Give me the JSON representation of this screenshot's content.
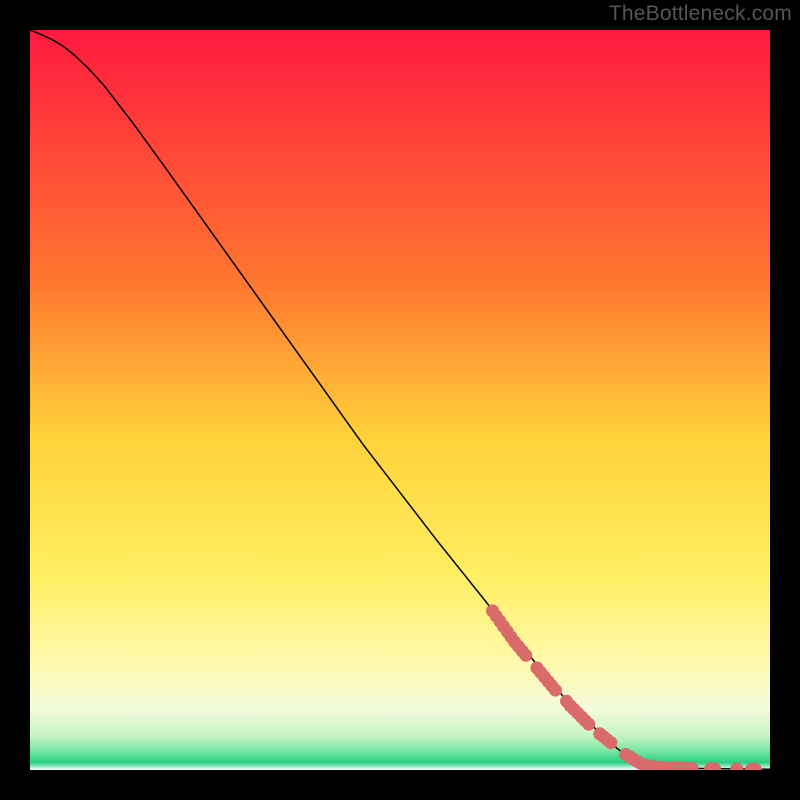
{
  "watermark": "TheBottleneck.com",
  "colors": {
    "top": "#ff193f",
    "orange": "#ff9e32",
    "yellow": "#ffe952",
    "cream": "#fffab0",
    "pale": "#f0fcdc",
    "mint": "#9aeeba",
    "green": "#28d082",
    "point_fill": "#d96b6b",
    "point_stroke": "#a73f3f",
    "curve": "#000000"
  },
  "chart_data": {
    "type": "line",
    "title": "",
    "xlabel": "",
    "ylabel": "",
    "xlim": [
      0,
      100
    ],
    "ylim": [
      0,
      100
    ],
    "gradient_stops": [
      {
        "offset": 0.0,
        "color": "#ff193f"
      },
      {
        "offset": 0.35,
        "color": "#ff7a2f"
      },
      {
        "offset": 0.55,
        "color": "#ffd23a"
      },
      {
        "offset": 0.74,
        "color": "#ffef62"
      },
      {
        "offset": 0.86,
        "color": "#fff9b0"
      },
      {
        "offset": 0.92,
        "color": "#f2fbdc"
      },
      {
        "offset": 0.955,
        "color": "#c4f3c3"
      },
      {
        "offset": 0.975,
        "color": "#72e6a3"
      },
      {
        "offset": 0.99,
        "color": "#29cf82"
      },
      {
        "offset": 1.0,
        "color": "#ffffff"
      }
    ],
    "curve": [
      {
        "x": 0.0,
        "y": 100.0
      },
      {
        "x": 1.5,
        "y": 99.4
      },
      {
        "x": 3.0,
        "y": 98.7
      },
      {
        "x": 4.5,
        "y": 97.8
      },
      {
        "x": 6.0,
        "y": 96.6
      },
      {
        "x": 8.0,
        "y": 94.7
      },
      {
        "x": 10.0,
        "y": 92.5
      },
      {
        "x": 14.0,
        "y": 87.3
      },
      {
        "x": 18.0,
        "y": 81.8
      },
      {
        "x": 25.0,
        "y": 72.0
      },
      {
        "x": 35.0,
        "y": 58.0
      },
      {
        "x": 45.0,
        "y": 44.0
      },
      {
        "x": 55.0,
        "y": 31.0
      },
      {
        "x": 65.0,
        "y": 18.5
      },
      {
        "x": 72.0,
        "y": 10.0
      },
      {
        "x": 78.0,
        "y": 4.0
      },
      {
        "x": 81.0,
        "y": 1.6
      },
      {
        "x": 83.5,
        "y": 0.6
      },
      {
        "x": 86.0,
        "y": 0.3
      },
      {
        "x": 90.0,
        "y": 0.2
      },
      {
        "x": 95.0,
        "y": 0.15
      },
      {
        "x": 100.0,
        "y": 0.1
      }
    ],
    "scatter": [
      {
        "x": 62.5,
        "y": 21.5
      },
      {
        "x": 63.0,
        "y": 20.8
      },
      {
        "x": 63.5,
        "y": 20.1
      },
      {
        "x": 64.0,
        "y": 19.4
      },
      {
        "x": 64.5,
        "y": 18.7
      },
      {
        "x": 65.0,
        "y": 18.0
      },
      {
        "x": 65.5,
        "y": 17.3
      },
      {
        "x": 66.0,
        "y": 16.7
      },
      {
        "x": 66.5,
        "y": 16.1
      },
      {
        "x": 67.0,
        "y": 15.5
      },
      {
        "x": 68.5,
        "y": 13.8
      },
      {
        "x": 69.0,
        "y": 13.2
      },
      {
        "x": 69.5,
        "y": 12.6
      },
      {
        "x": 70.0,
        "y": 12.0
      },
      {
        "x": 70.5,
        "y": 11.4
      },
      {
        "x": 71.0,
        "y": 10.8
      },
      {
        "x": 72.5,
        "y": 9.3
      },
      {
        "x": 73.0,
        "y": 8.7
      },
      {
        "x": 73.5,
        "y": 8.2
      },
      {
        "x": 74.0,
        "y": 7.7
      },
      {
        "x": 74.5,
        "y": 7.2
      },
      {
        "x": 75.0,
        "y": 6.7
      },
      {
        "x": 75.5,
        "y": 6.2
      },
      {
        "x": 77.0,
        "y": 4.9
      },
      {
        "x": 77.5,
        "y": 4.5
      },
      {
        "x": 78.0,
        "y": 4.1
      },
      {
        "x": 78.5,
        "y": 3.7
      },
      {
        "x": 80.5,
        "y": 2.1
      },
      {
        "x": 81.0,
        "y": 1.8
      },
      {
        "x": 81.5,
        "y": 1.5
      },
      {
        "x": 82.0,
        "y": 1.2
      },
      {
        "x": 82.5,
        "y": 0.9
      },
      {
        "x": 83.0,
        "y": 0.7
      },
      {
        "x": 83.5,
        "y": 0.55
      },
      {
        "x": 84.0,
        "y": 0.45
      },
      {
        "x": 84.5,
        "y": 0.4
      },
      {
        "x": 85.0,
        "y": 0.35
      },
      {
        "x": 85.5,
        "y": 0.32
      },
      {
        "x": 86.0,
        "y": 0.3
      },
      {
        "x": 86.5,
        "y": 0.28
      },
      {
        "x": 87.0,
        "y": 0.27
      },
      {
        "x": 87.5,
        "y": 0.26
      },
      {
        "x": 88.0,
        "y": 0.25
      },
      {
        "x": 88.5,
        "y": 0.24
      },
      {
        "x": 89.0,
        "y": 0.23
      },
      {
        "x": 89.5,
        "y": 0.22
      },
      {
        "x": 92.0,
        "y": 0.19
      },
      {
        "x": 92.5,
        "y": 0.18
      },
      {
        "x": 95.5,
        "y": 0.14
      },
      {
        "x": 97.5,
        "y": 0.12
      },
      {
        "x": 98.0,
        "y": 0.11
      }
    ]
  }
}
